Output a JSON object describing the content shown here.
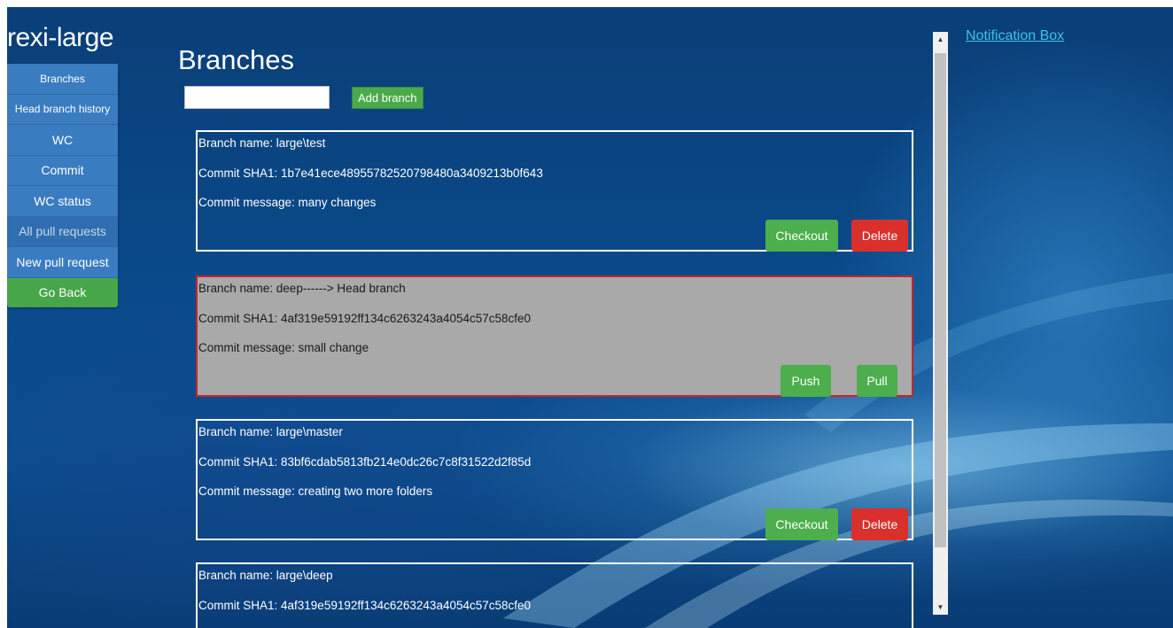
{
  "app": {
    "title": "rexi-large"
  },
  "sidebar": {
    "items": [
      {
        "label": "Branches"
      },
      {
        "label": "Head branch history"
      },
      {
        "label": "WC"
      },
      {
        "label": "Commit"
      },
      {
        "label": "WC status"
      },
      {
        "label": "All pull requests"
      },
      {
        "label": "New pull request"
      },
      {
        "label": "Go Back"
      }
    ]
  },
  "main": {
    "title": "Branches",
    "new_branch_input": {
      "value": "",
      "placeholder": ""
    },
    "add_branch_label": "Add branch",
    "branches": [
      {
        "name_line": "Branch name: large\\test",
        "sha_line": "Commit SHA1: 1b7e41ece48955782520798480a3409213b0f643",
        "message_line": "Commit message: many changes",
        "actions": [
          "Checkout",
          "Delete"
        ]
      },
      {
        "name_line": "Branch name: deep------> Head branch",
        "sha_line": "Commit SHA1: 4af319e59192ff134c6263243a4054c57c58cfe0",
        "message_line": "Commit message: small change",
        "actions": [
          "Push",
          "Pull"
        ]
      },
      {
        "name_line": "Branch name: large\\master",
        "sha_line": "Commit SHA1: 83bf6cdab5813fb214e0dc26c7c8f31522d2f85d",
        "message_line": "Commit message: creating two more folders",
        "actions": [
          "Checkout",
          "Delete"
        ]
      },
      {
        "name_line": "Branch name: large\\deep",
        "sha_line": "Commit SHA1: 4af319e59192ff134c6263243a4054c57c58cfe0"
      }
    ]
  },
  "notification": {
    "link_label": "Notification Box"
  },
  "colors": {
    "nav_blue": "#3a7cc0",
    "go_back_green": "#47a64a",
    "button_green": "#4cae4c",
    "button_red": "#d9302c",
    "head_card_bg": "#a9a9a9",
    "head_card_border": "#c8242b",
    "link_cyan": "#3fc1e6"
  },
  "icons": {
    "scroll_up": "scroll-up-arrow-icon",
    "scroll_down": "scroll-down-arrow-icon"
  }
}
